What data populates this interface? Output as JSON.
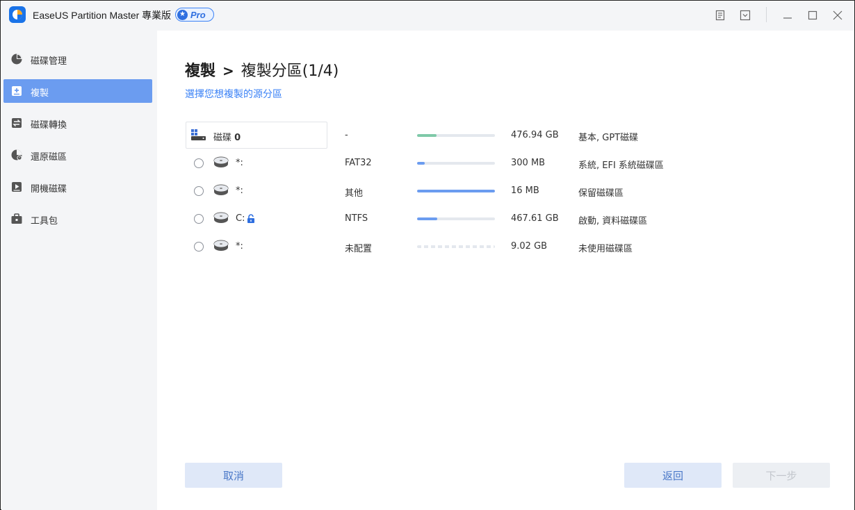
{
  "window": {
    "app_title": "EaseUS Partition Master 專業版",
    "badge": "Pro"
  },
  "sidebar": {
    "items": [
      {
        "label": "磁碟管理",
        "icon": "pie-chart-icon",
        "active": false
      },
      {
        "label": "複製",
        "icon": "clone-icon",
        "active": true
      },
      {
        "label": "磁碟轉換",
        "icon": "convert-icon",
        "active": false
      },
      {
        "label": "還原磁區",
        "icon": "recover-icon",
        "active": false
      },
      {
        "label": "開機磁碟",
        "icon": "bootable-media-icon",
        "active": false
      },
      {
        "label": "工具包",
        "icon": "toolkit-icon",
        "active": false
      }
    ]
  },
  "main": {
    "breadcrumb": {
      "root": "複製",
      "separator": ">",
      "current": "複製分區(1/4)"
    },
    "subtitle": "選擇您想複製的源分區",
    "disk": {
      "name": "磁碟 0",
      "fs": "-",
      "size": "476.94 GB",
      "type": "基本, GPT磁碟",
      "usage": 0.25,
      "usage_color": "#7fc9a8"
    },
    "partitions": [
      {
        "name": "*:",
        "locked": false,
        "fs": "FAT32",
        "size": "300 MB",
        "type": "系統, EFI 系統磁碟區",
        "usage": 0.1,
        "unallocated": false
      },
      {
        "name": "*:",
        "locked": false,
        "fs": "其他",
        "size": "16 MB",
        "type": "保留磁碟區",
        "usage": 1.0,
        "unallocated": false
      },
      {
        "name": "C:",
        "locked": true,
        "fs": "NTFS",
        "size": "467.61 GB",
        "type": "啟動, 資料磁碟區",
        "usage": 0.26,
        "unallocated": false
      },
      {
        "name": "*:",
        "locked": false,
        "fs": "未配置",
        "size": "9.02 GB",
        "type": "未使用磁碟區",
        "usage": 0,
        "unallocated": true
      }
    ],
    "buttons": {
      "cancel": "取消",
      "back": "返回",
      "next": "下一步"
    }
  },
  "colors": {
    "accent": "#3b82f6",
    "active_nav": "#6b9cf0",
    "bar_fill": "#6b9cf0"
  }
}
